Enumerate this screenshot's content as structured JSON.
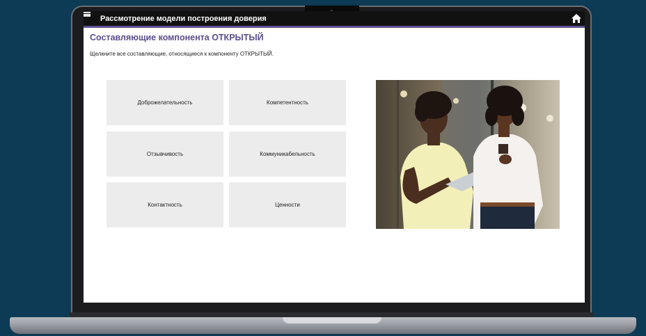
{
  "header": {
    "title": "Рассмотрение модели построения доверия"
  },
  "page": {
    "heading": "Составляющие компонента ОТКРЫТЫЙ",
    "instructions": "Щелкните все составляющие, относящиеся к компоненту ОТКРЫТЫЙ."
  },
  "tiles": [
    {
      "label": "Доброжелательность"
    },
    {
      "label": "Компетентность"
    },
    {
      "label": "Отзывчивость"
    },
    {
      "label": "Коммуникабельность"
    },
    {
      "label": "Контактность"
    },
    {
      "label": "Ценности"
    }
  ],
  "icons": {
    "menu": "menu-icon",
    "home": "home-icon"
  },
  "colors": {
    "accent": "#5b4e8c",
    "topbar": "#111111",
    "tile_bg": "#ececec",
    "background": "#0d3a55"
  }
}
